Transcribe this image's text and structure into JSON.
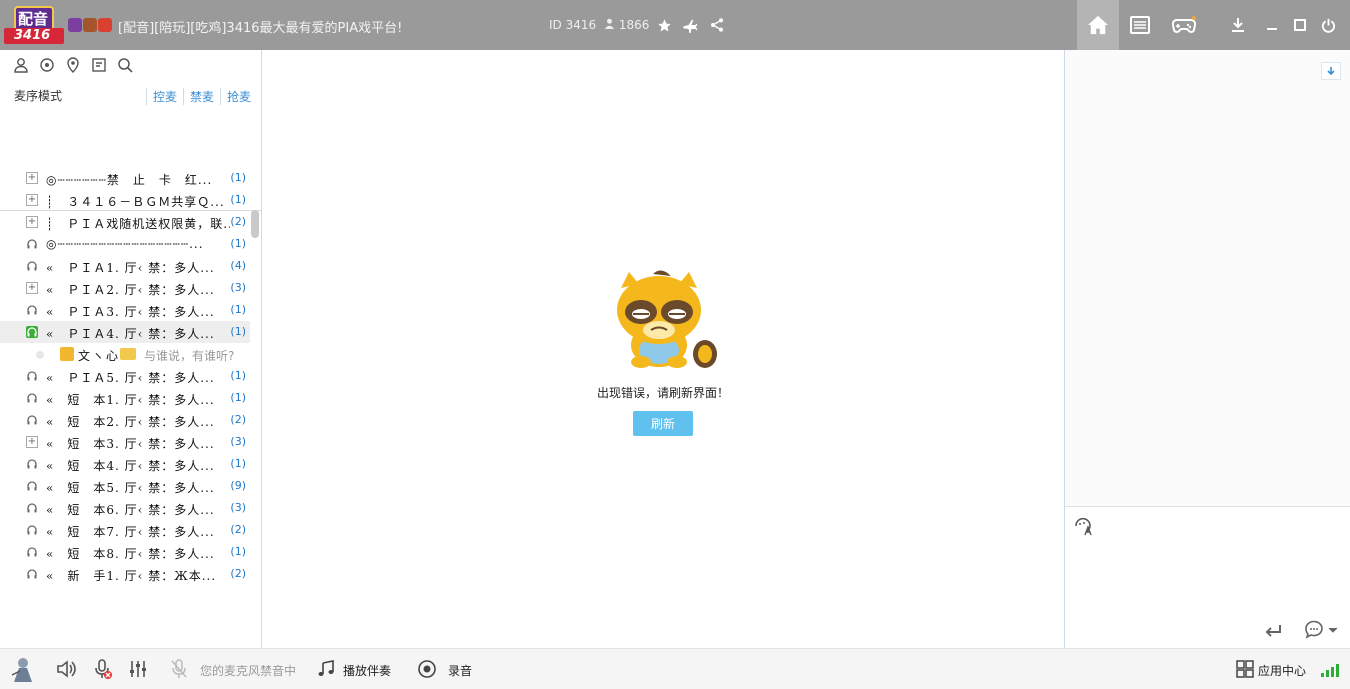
{
  "titlebar": {
    "logo_top": "配音",
    "logo_bottom": "3416",
    "title": "[配音][陪玩][吃鸡]3416最大最有爱的PIA戏平台!",
    "room_id": "ID 3416",
    "online_count": "1866"
  },
  "left": {
    "mic_mode": "麦序模式",
    "links": [
      "控麦",
      "禁麦",
      "抢麦"
    ]
  },
  "channels": [
    {
      "icon": "plus",
      "name": "◎┄┄┄┄┄┄禁　止　卡　红...",
      "count": "(1)"
    },
    {
      "icon": "plus",
      "name": "┊　３４１６－ＢＧＭ共享Ｑ...",
      "count": "(1)"
    },
    {
      "icon": "plus",
      "name": "┊　ＰＩＡ戏随机送权限黄，联...",
      "count": "(2)"
    },
    {
      "icon": "headphone",
      "name": "◎┄┄┄┄┄┄┄┄┄┄┄┄┄┄┄┄...",
      "count": "(1)"
    },
    {
      "icon": "headphone",
      "name": "«　ＰＩＡ1. 厅‹ 禁：多人...",
      "count": "(4)"
    },
    {
      "icon": "plus",
      "name": "«　ＰＩＡ2. 厅‹ 禁：多人...",
      "count": "(3)"
    },
    {
      "icon": "headphone",
      "name": "«　ＰＩＡ3. 厅‹ 禁：多人...",
      "count": "(1)"
    },
    {
      "icon": "headphone-active",
      "name": "«　ＰＩＡ4. 厅‹ 禁：多人...",
      "count": "(1)"
    }
  ],
  "user_row": {
    "name": "文ヽ心",
    "signature": "与谁说，有谁听?"
  },
  "channels2": [
    {
      "icon": "headphone",
      "name": "«　ＰＩＡ5. 厅‹ 禁：多人...",
      "count": "(1)"
    },
    {
      "icon": "headphone",
      "name": "«　短　本1. 厅‹ 禁：多人...",
      "count": "(1)"
    },
    {
      "icon": "headphone",
      "name": "«　短　本2. 厅‹ 禁：多人...",
      "count": "(2)"
    },
    {
      "icon": "plus",
      "name": "«　短　本3. 厅‹ 禁：多人...",
      "count": "(3)"
    },
    {
      "icon": "headphone",
      "name": "«　短　本4. 厅‹ 禁：多人...",
      "count": "(1)"
    },
    {
      "icon": "headphone",
      "name": "«　短　本5. 厅‹ 禁：多人...",
      "count": "(9)"
    },
    {
      "icon": "headphone",
      "name": "«　短　本6. 厅‹ 禁：多人...",
      "count": "(3)"
    },
    {
      "icon": "headphone",
      "name": "«　短　本7. 厅‹ 禁：多人...",
      "count": "(2)"
    },
    {
      "icon": "headphone",
      "name": "«　短　本8. 厅‹ 禁：多人...",
      "count": "(1)"
    },
    {
      "icon": "headphone",
      "name": "«　新　手1. 厅‹ 禁：Ж本...",
      "count": "(2)"
    }
  ],
  "center": {
    "error_text": "出现错误，请刷新界面！",
    "refresh_label": "刷新"
  },
  "bottom": {
    "mic_status": "您的麦克风禁音中",
    "play_accompaniment": "播放伴奏",
    "record": "录音",
    "app_center": "应用中心"
  },
  "colors": {
    "titlebar": "#9a9a9a",
    "accent": "#3a8fd6",
    "refresh": "#61c1ee",
    "signal": "#2eac3a"
  }
}
